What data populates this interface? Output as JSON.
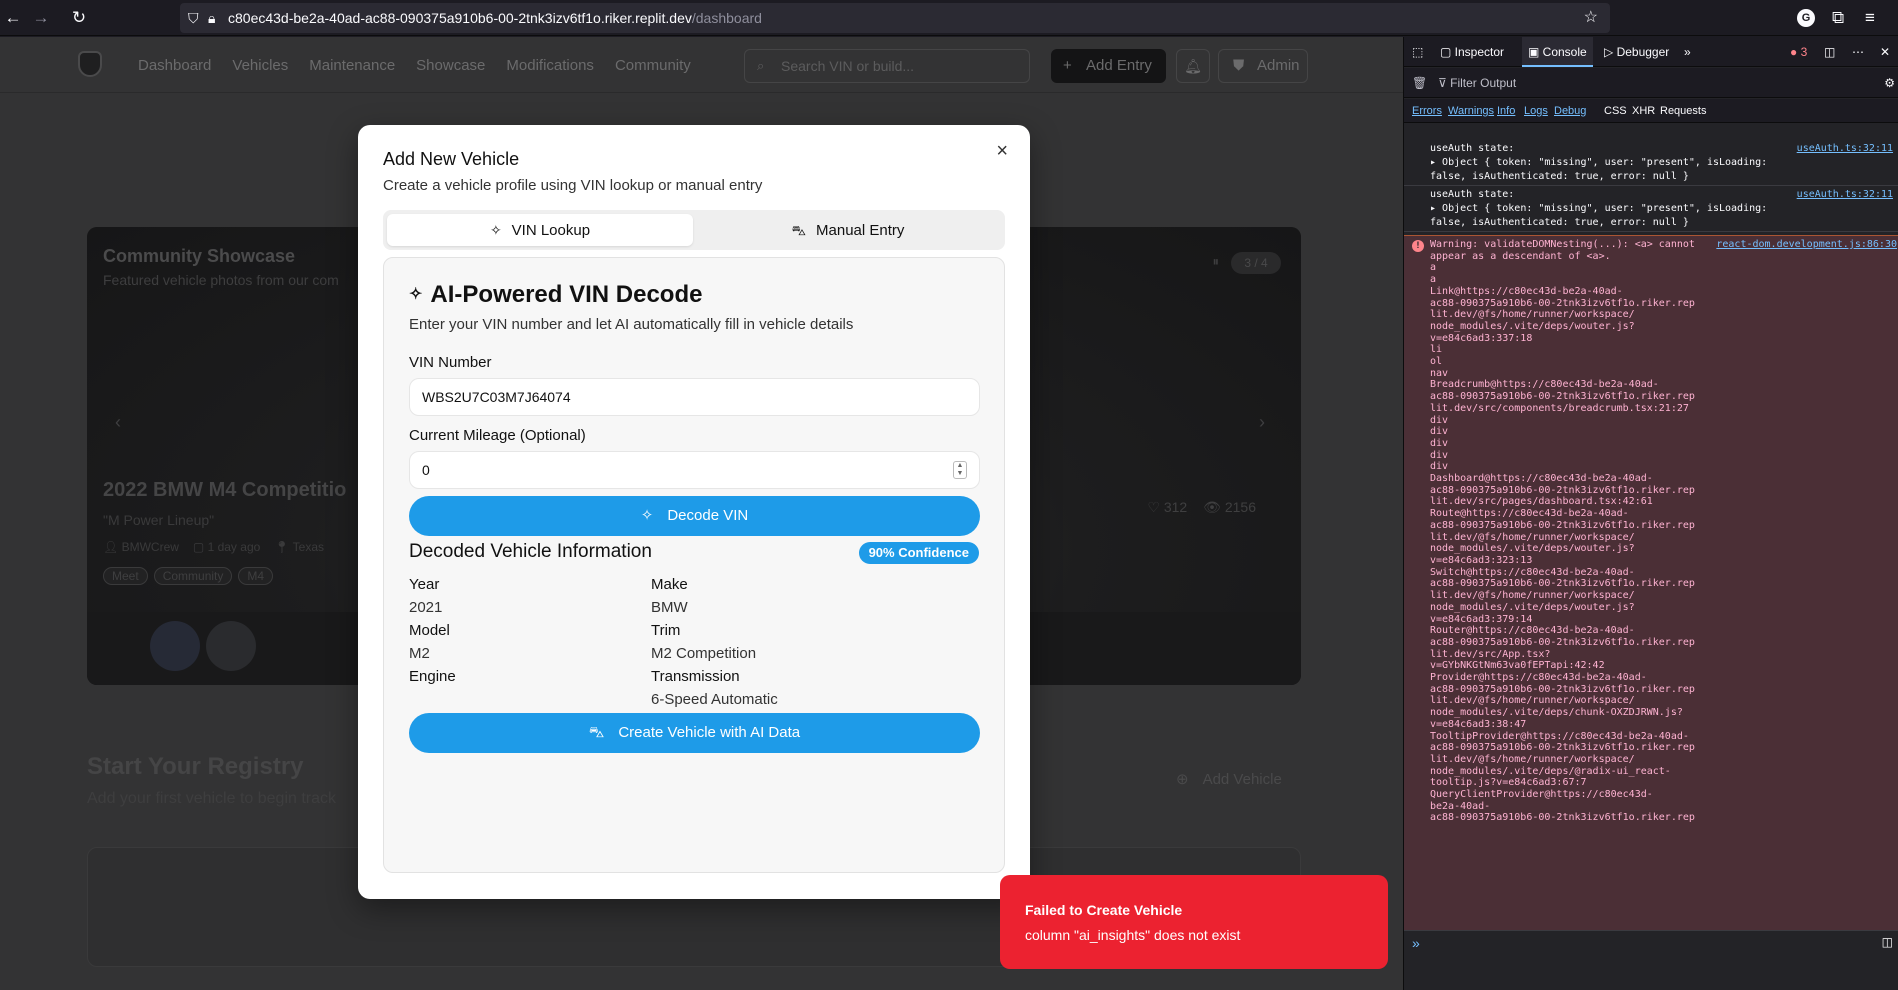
{
  "browser": {
    "url_host": "c80ec43d-be2a-40ad-ac88-090375a910b6-00-2tnk3izv6tf1o.riker.replit.dev",
    "url_path": "/dashboard"
  },
  "app": {
    "nav": [
      "Dashboard",
      "Vehicles",
      "Maintenance",
      "Showcase",
      "Modifications",
      "Community"
    ],
    "search_placeholder": "Search VIN or build...",
    "add_entry": "Add Entry",
    "admin": "Admin",
    "showcase": {
      "title": "Community Showcase",
      "subtitle": "Featured vehicle photos from our com",
      "counter": "3 / 4",
      "car": "2022 BMW M4 Competitio",
      "quote": "\"M Power Lineup\"",
      "user": "BMWCrew",
      "time": "1 day ago",
      "location": "Texas",
      "tags": [
        "Meet",
        "Community",
        "M4"
      ],
      "likes": "312",
      "views": "2156"
    },
    "registry_title": "Start Your Registry",
    "registry_sub": "Add your first vehicle to begin track",
    "registry_add": "Add Vehicle"
  },
  "modal": {
    "title": "Add New Vehicle",
    "description": "Create a vehicle profile using VIN lookup or manual entry",
    "tab_vin": "VIN Lookup",
    "tab_manual": "Manual Entry",
    "panel_title": "AI-Powered VIN Decode",
    "panel_desc": "Enter your VIN number and let AI automatically fill in vehicle details",
    "vin_label": "VIN Number",
    "vin_value": "WBS2U7C03M7J64074",
    "mileage_label": "Current Mileage (Optional)",
    "mileage_value": "0",
    "decode_btn": "Decode VIN",
    "decoded_title": "Decoded Vehicle Information",
    "confidence": "90% Confidence",
    "fields": {
      "year_label": "Year",
      "year": "2021",
      "make_label": "Make",
      "make": "BMW",
      "model_label": "Model",
      "model": "M2",
      "trim_label": "Trim",
      "trim": "M2 Competition",
      "engine_label": "Engine",
      "engine": "",
      "trans_label": "Transmission",
      "trans": "6-Speed Automatic"
    },
    "create_btn": "Create Vehicle with AI Data"
  },
  "toast": {
    "title": "Failed to Create Vehicle",
    "message": "column \"ai_insights\" does not exist"
  },
  "devtools": {
    "tabs": [
      "Inspector",
      "Console",
      "Debugger"
    ],
    "error_count": "3",
    "filter_placeholder": "Filter Output",
    "filters": [
      "Errors",
      "Warnings",
      "Info",
      "Logs",
      "Debug",
      "CSS",
      "XHR",
      "Requests"
    ],
    "log1_title": "useAuth state:",
    "log1_body": "Object { token: \"missing\", user: \"present\", isLoading:",
    "log1_body2": "false, isAuthenticated: true, error: null }",
    "log1_src": "useAuth.ts:32:11",
    "log2_title": "useAuth state:",
    "log2_body": "Object { token: \"missing\", user: \"present\", isLoading:",
    "log2_body2": "false, isAuthenticated: true, error: null }",
    "log2_src": "useAuth.ts:32:11",
    "warn_src": "react-dom.development.js:86:30",
    "warn_lines": [
      "Warning: validateDOMNesting(...): <a> cannot",
      "appear as a descendant of <a>.",
      "a",
      "a",
      "Link@https://c80ec43d-be2a-40ad-",
      "ac88-090375a910b6-00-2tnk3izv6tf1o.riker.rep",
      "lit.dev/@fs/home/runner/workspace/",
      "node_modules/.vite/deps/wouter.js?",
      "v=e84c6ad3:337:18",
      "li",
      "ol",
      "nav",
      "Breadcrumb@https://c80ec43d-be2a-40ad-",
      "ac88-090375a910b6-00-2tnk3izv6tf1o.riker.rep",
      "lit.dev/src/components/breadcrumb.tsx:21:27",
      "div",
      "div",
      "div",
      "div",
      "div",
      "Dashboard@https://c80ec43d-be2a-40ad-",
      "ac88-090375a910b6-00-2tnk3izv6tf1o.riker.rep",
      "lit.dev/src/pages/dashboard.tsx:42:61",
      "Route@https://c80ec43d-be2a-40ad-",
      "ac88-090375a910b6-00-2tnk3izv6tf1o.riker.rep",
      "lit.dev/@fs/home/runner/workspace/",
      "node_modules/.vite/deps/wouter.js?",
      "v=e84c6ad3:323:13",
      "Switch@https://c80ec43d-be2a-40ad-",
      "ac88-090375a910b6-00-2tnk3izv6tf1o.riker.rep",
      "lit.dev/@fs/home/runner/workspace/",
      "node_modules/.vite/deps/wouter.js?",
      "v=e84c6ad3:379:14",
      "Router@https://c80ec43d-be2a-40ad-",
      "ac88-090375a910b6-00-2tnk3izv6tf1o.riker.rep",
      "lit.dev/src/App.tsx?",
      "v=GYbNKGtNm63va0fEPTapi:42:42",
      "Provider@https://c80ec43d-be2a-40ad-",
      "ac88-090375a910b6-00-2tnk3izv6tf1o.riker.rep",
      "lit.dev/@fs/home/runner/workspace/",
      "node_modules/.vite/deps/chunk-OXZDJRWN.js?",
      "v=e84c6ad3:38:47",
      "TooltipProvider@https://c80ec43d-be2a-40ad-",
      "ac88-090375a910b6-00-2tnk3izv6tf1o.riker.rep",
      "lit.dev/@fs/home/runner/workspace/",
      "node_modules/.vite/deps/@radix-ui_react-",
      "tooltip.js?v=e84c6ad3:67:7",
      "QueryClientProvider@https://c80ec43d-",
      "be2a-40ad-",
      "ac88-090375a910b6-00-2tnk3izv6tf1o.riker.rep"
    ]
  }
}
